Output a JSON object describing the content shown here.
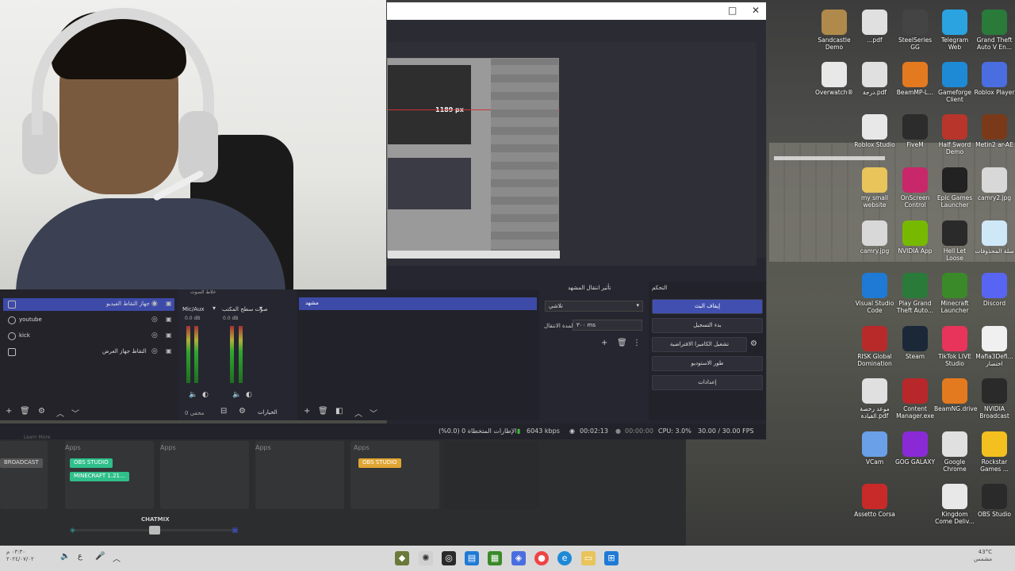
{
  "obs": {
    "preview_px_label": "1189 px",
    "docks": {
      "scenes_header": "مشهد",
      "transitions_header": "تأثير انتقال المشهد",
      "controls_header": "التحكم"
    },
    "sources": [
      {
        "label": "جهاز التقاط الفيديو",
        "selected": true
      },
      {
        "label": "youtube",
        "selected": false
      },
      {
        "label": "kick",
        "selected": false
      },
      {
        "label": "التقاط جهاز العرض",
        "selected": false
      }
    ],
    "mixer": {
      "header": "خلاط الصوت",
      "channels": [
        {
          "name": "Mic/Aux",
          "db": "0.0 dB"
        },
        {
          "name": "صوت سطح المكتب",
          "db": "0.0 dB"
        }
      ],
      "bottom_label": "0 مخفي"
    },
    "scenes": {
      "selected": "مشهد",
      "filters_label": "الخيارات"
    },
    "transitions": {
      "type": "تلاشي",
      "duration_label": "المدة الانتقال",
      "duration_value": "٣٠٠ ms"
    },
    "controls": [
      {
        "label": "إيقاف البث",
        "primary": true
      },
      {
        "label": "بدء التسجيل",
        "primary": false
      },
      {
        "label": "تشغيل الكاميرا الافتراضية",
        "primary": false
      },
      {
        "label": "طور الاستوديو",
        "primary": false
      },
      {
        "label": "إعدادات",
        "primary": false
      }
    ],
    "status": {
      "dropped_frames": "الإطارات المتخطاة 0 (0.0%)",
      "bitrate": "6043 kbps",
      "stream_time": "00:02:13",
      "record_time": "00:00:00",
      "cpu": "CPU: 3.0%",
      "fps": "30.00 / 30.00 FPS"
    }
  },
  "lower": {
    "col_labels": [
      "Apps",
      "Apps",
      "Apps",
      "Apps"
    ],
    "learn_more": "Learn More",
    "tags": {
      "broadcast": "BROADCAST",
      "obs_studio_1": "OBS STUDIO",
      "minecraft": "MINECRAFT 1.21...",
      "obs_studio_2": "OBS STUDIO"
    },
    "chatmix": "CHATMIX"
  },
  "desktop_icons": [
    {
      "label": "Sandcastle Demo",
      "icon": "castle-icon",
      "color": "#b08a4a"
    },
    {
      "label": "...pdf",
      "icon": "chrome-pdf-icon",
      "color": "#e0e0e0"
    },
    {
      "label": "SteelSeries GG",
      "icon": "steelseries-icon",
      "color": "#444"
    },
    {
      "label": "Telegram Web",
      "icon": "telegram-icon",
      "color": "#2aa3e0"
    },
    {
      "label": "Grand Theft Auto V En...",
      "icon": "gta-icon",
      "color": "#2a7a3a"
    },
    {
      "label": "Overwatch®",
      "icon": "overwatch-icon",
      "color": "#e8e8e8"
    },
    {
      "label": "درجة.pdf",
      "icon": "chrome-pdf-icon",
      "color": "#e0e0e0"
    },
    {
      "label": "BeamMP-L...",
      "icon": "beammp-icon",
      "color": "#e47a1f"
    },
    {
      "label": "Gameforge Client",
      "icon": "gameforge-icon",
      "color": "#1e8ad6"
    },
    {
      "label": "Roblox Player",
      "icon": "roblox-icon",
      "color": "#4a6de0"
    },
    {
      "label": "Roblox Studio",
      "icon": "roblox-studio-icon",
      "color": "#e8e8e8"
    },
    {
      "label": "FiveM",
      "icon": "fivem-icon",
      "color": "#2c2c2c"
    },
    {
      "label": "Half Sword Demo",
      "icon": "halfsword-icon",
      "color": "#b8352c"
    },
    {
      "label": "Metin2 ar-AE",
      "icon": "metin2-icon",
      "color": "#7a3a1a"
    },
    {
      "label": "my small website",
      "icon": "folder-icon",
      "color": "#e8c45a"
    },
    {
      "label": "OnScreen Control",
      "icon": "onscreen-icon",
      "color": "#c8286a"
    },
    {
      "label": "Epic Games Launcher",
      "icon": "epic-icon",
      "color": "#222"
    },
    {
      "label": "camry2.jpg",
      "icon": "image-icon",
      "color": "#d8d8d8"
    },
    {
      "label": "camry.jpg",
      "icon": "image-icon",
      "color": "#d8d8d8"
    },
    {
      "label": "NVIDIA App",
      "icon": "nvidia-icon",
      "color": "#76b900"
    },
    {
      "label": "Hell Let Loose",
      "icon": "hellletloose-icon",
      "color": "#2a2a2a"
    },
    {
      "label": "سلة المحذوفات",
      "icon": "recycle-bin-icon",
      "color": "#cfe8f8"
    },
    {
      "label": "Visual Studio Code",
      "icon": "vscode-icon",
      "color": "#1f7ad6"
    },
    {
      "label": "Play Grand Theft Auto...",
      "icon": "gta-icon",
      "color": "#2a7a3a"
    },
    {
      "label": "Minecraft Launcher",
      "icon": "minecraft-icon",
      "color": "#3a8a2a"
    },
    {
      "label": "Discord",
      "icon": "discord-icon",
      "color": "#5865f2"
    },
    {
      "label": "RISK Global Domination",
      "icon": "risk-icon",
      "color": "#b82a2a"
    },
    {
      "label": "Steam",
      "icon": "steam-icon",
      "color": "#1b2838"
    },
    {
      "label": "TikTok LIVE Studio",
      "icon": "tiktok-icon",
      "color": "#e8345a"
    },
    {
      "label": "Mafia3Defi... اختصار",
      "icon": "shortcut-icon",
      "color": "#f0f0f0"
    },
    {
      "label": "موعد رخصة القيادة.pdf",
      "icon": "chrome-pdf-icon",
      "color": "#e0e0e0"
    },
    {
      "label": "Content Manager.exe",
      "icon": "content-manager-icon",
      "color": "#b8282a"
    },
    {
      "label": "BeamNG.drive",
      "icon": "beamng-icon",
      "color": "#e47a1f"
    },
    {
      "label": "NVIDIA Broadcast",
      "icon": "nvidia-broadcast-icon",
      "color": "#2a2a2a"
    },
    {
      "label": "VCam",
      "icon": "vcam-icon",
      "color": "#6aa0e8"
    },
    {
      "label": "GOG GALAXY",
      "icon": "gog-icon",
      "color": "#8a2ad6"
    },
    {
      "label": "Google Chrome",
      "icon": "chrome-icon",
      "color": "#e0e0e0"
    },
    {
      "label": "Rockstar Games ...",
      "icon": "rockstar-icon",
      "color": "#f4c020"
    },
    {
      "label": "Assetto Corsa",
      "icon": "assetto-icon",
      "color": "#c82a2a"
    },
    {
      "label": "Kingdom Come Deliv...",
      "icon": "kingdom-icon",
      "color": "#e8e8e8"
    },
    {
      "label": "OBS Studio",
      "icon": "obs-icon",
      "color": "#2a2a2a"
    }
  ],
  "taskbar": {
    "time": "٠٣:٣٠ م",
    "date": "٢٠٢٤/٠٧/٠٢",
    "weather_temp": "43°C",
    "weather_desc": "مشمس"
  }
}
